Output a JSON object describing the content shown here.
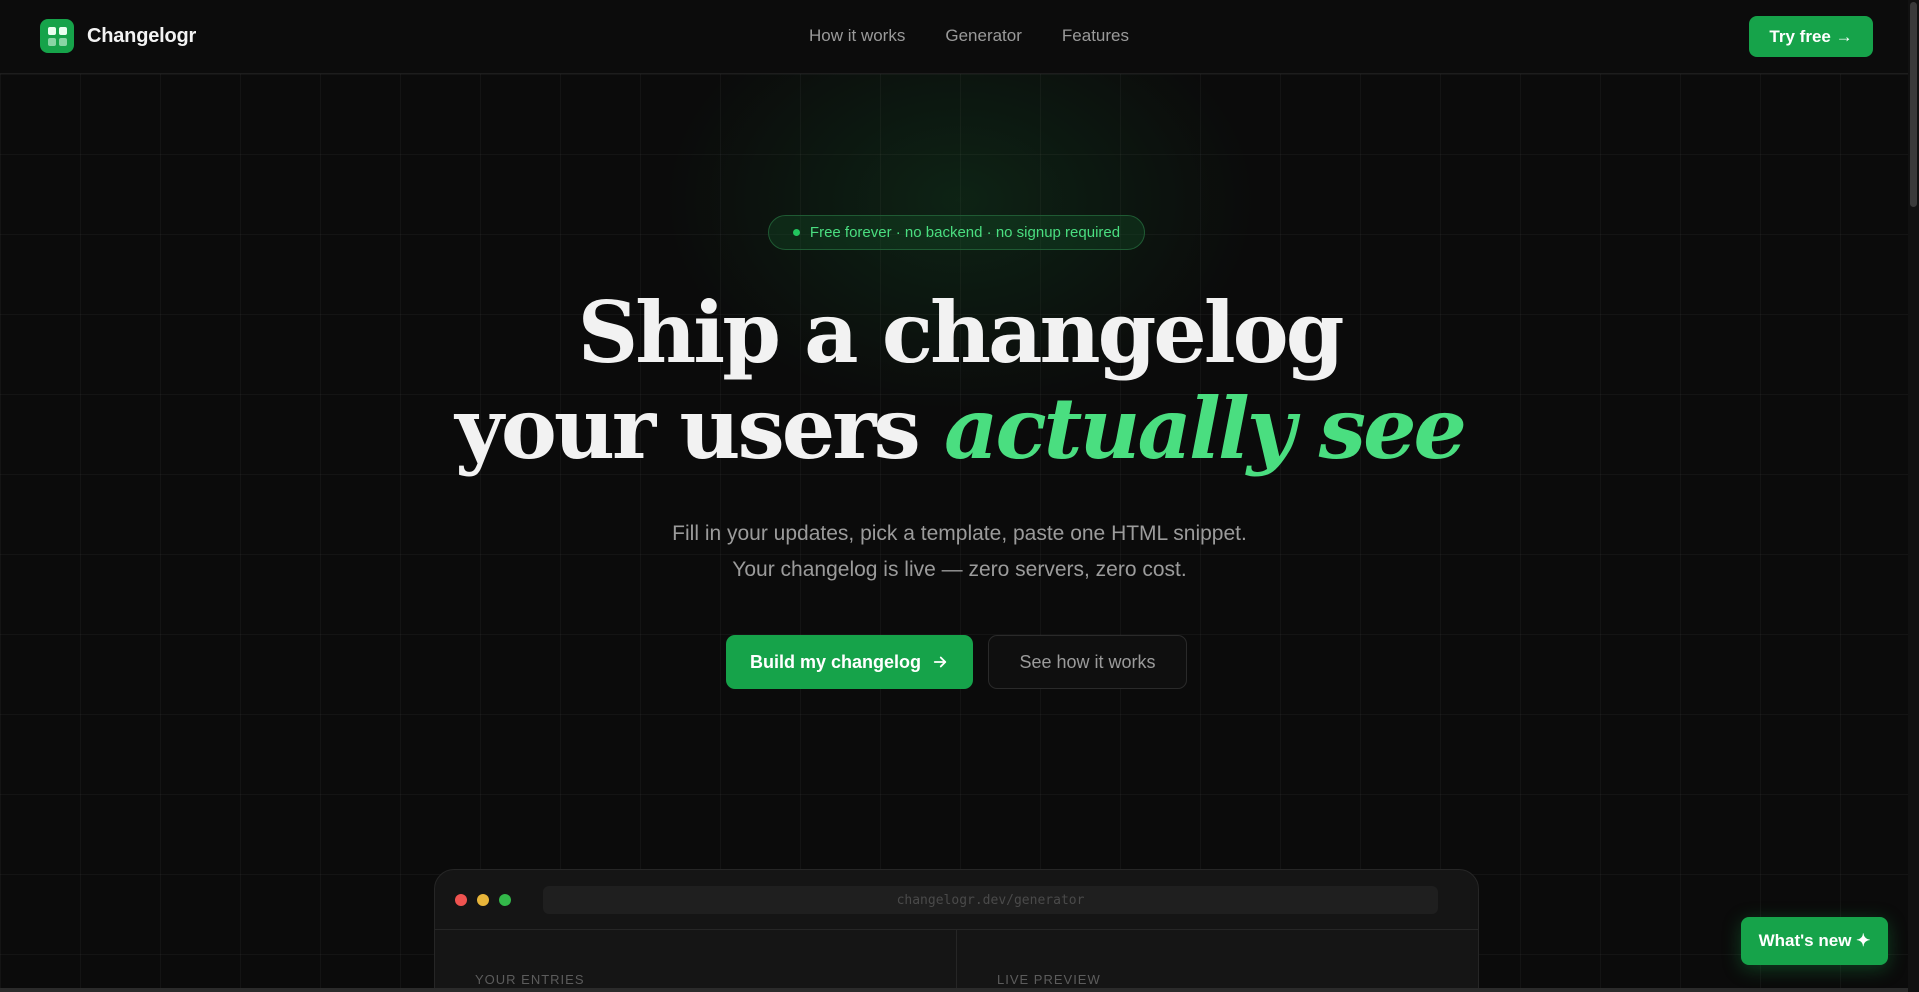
{
  "nav": {
    "brand": "Changelogr",
    "links": [
      {
        "label": "How it works"
      },
      {
        "label": "Generator"
      },
      {
        "label": "Features"
      }
    ],
    "cta_label": "Try free →"
  },
  "hero": {
    "badge": "Free forever · no backend · no signup required",
    "headline_line1": "Ship a changelog",
    "headline_line2_plain": "your users ",
    "headline_line2_accent": "actually see",
    "sub_line1": "Fill in your updates, pick a template, paste one HTML snippet.",
    "sub_line2": "Your changelog is live — zero servers, zero cost.",
    "primary_cta": "Build my changelog",
    "secondary_cta": "See how it works"
  },
  "preview": {
    "url": "changelogr.dev/generator",
    "left_label": "YOUR ENTRIES",
    "right_label": "LIVE PREVIEW"
  },
  "floating": {
    "whats_new": "What's new ✦"
  },
  "colors": {
    "accent": "#16a34a",
    "accent_text": "#4ade80",
    "background": "#0b0b0b"
  }
}
